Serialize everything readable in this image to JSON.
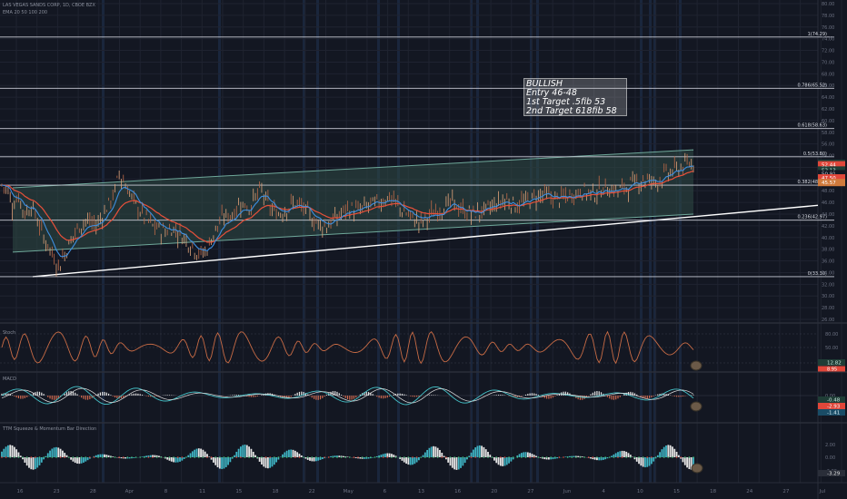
{
  "header": {
    "symbol_line": "LAS VEGAS SANDS CORP, 1D, CBOE BZX",
    "indicator_line": "EMA 20 50 100 200",
    "stoch_label": "Stoch",
    "macd_label": "MACD",
    "ttm_label": "TTM Squeeze & Momentum Bar Direction"
  },
  "annotation": {
    "lines": [
      "BULLISH",
      "Entry 46-48",
      "1st Target .5fib 53",
      "2nd Target 618fib 58"
    ]
  },
  "colors": {
    "background": "#131722",
    "grid": "#1f2330",
    "fib_line": "#c9ccd6",
    "channel_fill": "#2f4a45",
    "price": "#d9895c",
    "ema_red": "#e8503a",
    "ema_blue": "#3e8fe0",
    "macd_teal": "#44c2c8",
    "ttm_teal": "#3fb4c4",
    "ttm_white": "#e6e6e6",
    "label_green_bg": "#1f3d36",
    "label_red_bg": "#e0473a",
    "label_orange_bg": "#d07a3c"
  },
  "fib_levels": [
    {
      "label": "1(74.29)",
      "value": 74.29
    },
    {
      "label": "0.786(65.52)",
      "value": 65.52
    },
    {
      "label": "0.618(58.63)",
      "value": 58.63
    },
    {
      "label": "0.5(53.80)",
      "value": 53.8
    },
    {
      "label": "0.382(48.96)",
      "value": 48.96
    },
    {
      "label": "0.236(42.97)",
      "value": 42.97
    },
    {
      "label": "0(33.30)",
      "value": 33.3
    }
  ],
  "price_axis": {
    "ticks": [
      "80.00",
      "78.00",
      "76.00",
      "74.00",
      "72.00",
      "70.00",
      "68.00",
      "66.00",
      "64.00",
      "62.00",
      "60.00",
      "58.00",
      "56.00",
      "54.00",
      "52.00",
      "50.00",
      "48.00",
      "46.00",
      "44.00",
      "42.00",
      "40.00",
      "38.00",
      "36.00",
      "34.00",
      "32.00",
      "30.00",
      "28.00",
      "26.00"
    ],
    "labels": [
      {
        "text": "52.70",
        "style": "green",
        "value": 52.7
      },
      {
        "text": "52.44",
        "style": "red",
        "value": 52.44
      },
      {
        "text": "52.13",
        "style": "green",
        "value": 51.55
      },
      {
        "text": "50.91",
        "style": "dark",
        "value": 50.91
      },
      {
        "text": "47.50",
        "style": "red",
        "value": 50.2
      },
      {
        "text": "45.57",
        "style": "orange",
        "value": 49.4
      }
    ]
  },
  "stoch_axis": {
    "ticks": [
      "80.00",
      "50.00",
      "20.00"
    ],
    "label": "12.82",
    "label2": "8.95"
  },
  "macd_axis": {
    "ticks": [
      "0.00"
    ],
    "labels": [
      "-0.48",
      "-2.93",
      "-1.41"
    ]
  },
  "ttm_axis": {
    "ticks": [
      "2.00",
      "0.00",
      "-2.00"
    ],
    "label": "-3.29"
  },
  "time_axis": {
    "labels": [
      "16",
      "23",
      "28",
      "Apr",
      "8",
      "11",
      "15",
      "18",
      "22",
      "May",
      "6",
      "13",
      "16",
      "20",
      "27",
      "Jun",
      "4",
      "10",
      "15",
      "18",
      "24",
      "27",
      "Jul"
    ]
  },
  "chart_data": {
    "type": "candlestick",
    "title": "LAS VEGAS SANDS CORP, 1D, CBOE BZX",
    "y_range": [
      26,
      80
    ],
    "price_path": [
      [
        0,
        49
      ],
      [
        3,
        48
      ],
      [
        5,
        45.5
      ],
      [
        8,
        47
      ],
      [
        11,
        44
      ],
      [
        14,
        45.5
      ],
      [
        17,
        43
      ],
      [
        20,
        40
      ],
      [
        23,
        38
      ],
      [
        27,
        35
      ],
      [
        31,
        38
      ],
      [
        35,
        41
      ],
      [
        40,
        43
      ],
      [
        45,
        42
      ],
      [
        50,
        45
      ],
      [
        54,
        48
      ],
      [
        56,
        51
      ],
      [
        59,
        49
      ],
      [
        63,
        46
      ],
      [
        67,
        44
      ],
      [
        72,
        42
      ],
      [
        77,
        41
      ],
      [
        82,
        41.5
      ],
      [
        87,
        40
      ],
      [
        91,
        38.5
      ],
      [
        95,
        37
      ],
      [
        98,
        38
      ],
      [
        102,
        41.5
      ],
      [
        106,
        43.5
      ],
      [
        110,
        44
      ],
      [
        114,
        46
      ],
      [
        118,
        45
      ],
      [
        121,
        47
      ],
      [
        124,
        48
      ],
      [
        128,
        45
      ],
      [
        132,
        44
      ],
      [
        136,
        45
      ],
      [
        140,
        46
      ],
      [
        145,
        44.5
      ],
      [
        150,
        42.5
      ],
      [
        155,
        42
      ],
      [
        160,
        43.5
      ],
      [
        165,
        45
      ],
      [
        170,
        44.5
      ],
      [
        175,
        45.5
      ],
      [
        180,
        46
      ],
      [
        185,
        47
      ],
      [
        190,
        45
      ],
      [
        195,
        43.5
      ],
      [
        200,
        42.5
      ],
      [
        205,
        44
      ],
      [
        210,
        45
      ],
      [
        215,
        46
      ],
      [
        220,
        44.5
      ],
      [
        225,
        44
      ],
      [
        230,
        44.5
      ],
      [
        235,
        45.5
      ],
      [
        240,
        46.5
      ],
      [
        246,
        45.5
      ],
      [
        252,
        46.5
      ],
      [
        258,
        47.5
      ],
      [
        264,
        46.5
      ],
      [
        270,
        47
      ],
      [
        276,
        48
      ],
      [
        282,
        47.5
      ],
      [
        288,
        48.5
      ],
      [
        294,
        48
      ],
      [
        300,
        49
      ],
      [
        306,
        50
      ],
      [
        312,
        49.5
      ],
      [
        318,
        51
      ],
      [
        324,
        52
      ],
      [
        330,
        52.7
      ]
    ],
    "emas": {
      "red_end": 50.2,
      "blue_end": 51.55
    },
    "channel": {
      "upper_start": 48.5,
      "upper_end": 55,
      "lower_start": 37.5,
      "lower_end": 44
    },
    "trendline": {
      "start": 33.3,
      "end": 45.5
    }
  }
}
